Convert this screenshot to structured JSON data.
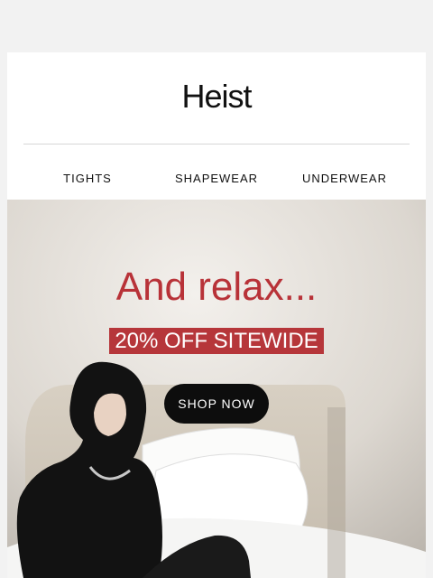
{
  "brand": {
    "logo_text": "Heist"
  },
  "nav": {
    "items": [
      {
        "label": "TIGHTS"
      },
      {
        "label": "SHAPEWEAR"
      },
      {
        "label": "UNDERWEAR"
      }
    ]
  },
  "hero": {
    "headline": "And relax...",
    "offer": "20% OFF SITEWIDE",
    "cta": "SHOP NOW"
  },
  "colors": {
    "accent_red": "#b83238",
    "cta_background": "#0d0d0d",
    "page_background": "#f2f2f2"
  }
}
